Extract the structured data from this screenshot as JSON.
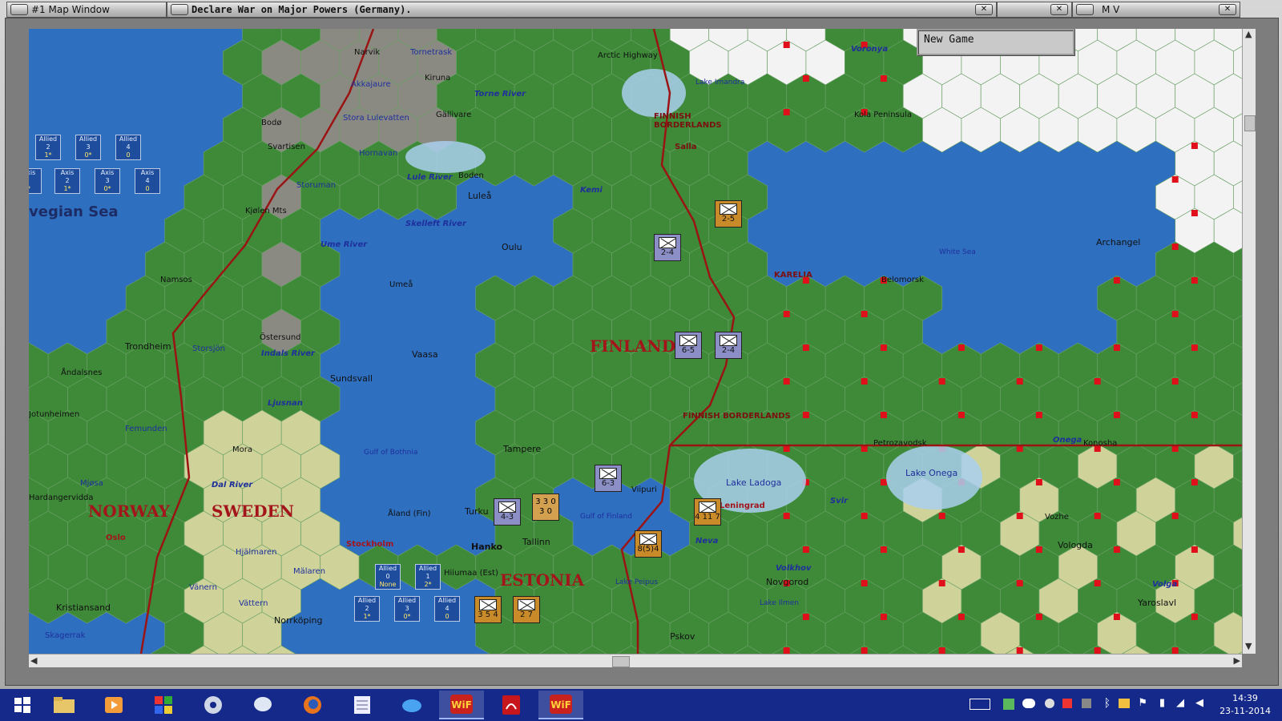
{
  "windows": {
    "map_window_title": "#1 Map Window",
    "main_title": "Declare War on Major Powers (Germany).",
    "mv_title": "M V",
    "panel_text": "New Game"
  },
  "map": {
    "ocean_label": "vegian Sea",
    "countries": [
      "FINLAND",
      "NORWAY",
      "SWEDEN",
      "ESTONIA"
    ],
    "regions": [
      "FINNISH BORDERLANDS",
      "FINNISH BORDERLANDS",
      "KARELIA"
    ],
    "seas": [
      "White Sea",
      "Gulf of Bothnia",
      "Gulf of Finland",
      "Lake Ladoga",
      "Lake Onega",
      "Lake Imandra",
      "Lake Peipus",
      "Lake Ilmen"
    ],
    "rivers": [
      "Torne River",
      "Lule River",
      "Ume River",
      "Skelleft River",
      "Indals River",
      "Ljusnan",
      "Dal River",
      "Kemi",
      "Onega",
      "Volga",
      "Svir",
      "Neva",
      "Volkhov",
      "Vozhe"
    ],
    "cities": [
      "Narvik",
      "Tornetrask",
      "Arctic Highway",
      "Voronya",
      "Kiruna",
      "Akkajaure",
      "Gällivare",
      "Bodø",
      "Stora Lulevatten",
      "Hornavan",
      "Svartisen",
      "Storuman",
      "Boden",
      "Luleå",
      "Kjølen Mts",
      "Kola Peninsula",
      "Salla",
      "Oulu",
      "Archangel",
      "Namsos",
      "Umeå",
      "Belomorsk",
      "Trondheim",
      "Storsjön",
      "Östersund",
      "Vaasa",
      "Sundsvall",
      "Åndalsnes",
      "Femunden",
      "Jotunheimen",
      "Mora",
      "Tampere",
      "Petrozavodsk",
      "Konosha",
      "Mjøsa",
      "Hardangervidda",
      "Viipuri",
      "Turku",
      "Åland (Fin)",
      "Leningrad",
      "Oslo",
      "Stockholm",
      "Hanko",
      "Tallinn",
      "Vologda",
      "Hjälmaren",
      "Mälaren",
      "Hiiumaa (Est)",
      "Novgorod",
      "Vänern",
      "Vättern",
      "Norrköping",
      "Kristiansand",
      "Skagerrak",
      "Yaroslavl",
      "Pskov"
    ]
  },
  "info_boxes": [
    {
      "side": "Allied",
      "num": "2",
      "val": "1*"
    },
    {
      "side": "Allied",
      "num": "3",
      "val": "0*"
    },
    {
      "side": "Allied",
      "num": "4",
      "val": "0"
    },
    {
      "side": "Axis",
      "num": "",
      "val": "*"
    },
    {
      "side": "Axis",
      "num": "2",
      "val": "1*"
    },
    {
      "side": "Axis",
      "num": "3",
      "val": "0*"
    },
    {
      "side": "Axis",
      "num": "4",
      "val": "0"
    },
    {
      "side": "Allied",
      "num": "0",
      "val": "None"
    },
    {
      "side": "Allied",
      "num": "1",
      "val": "2*"
    },
    {
      "side": "Allied",
      "num": "2",
      "val": "1*"
    },
    {
      "side": "Allied",
      "num": "3",
      "val": "0*"
    },
    {
      "side": "Allied",
      "num": "4",
      "val": "0"
    }
  ],
  "units": [
    {
      "type": "infantry",
      "side": "finnish",
      "strength": "2-4"
    },
    {
      "type": "infantry",
      "side": "finnish",
      "strength": "6-5"
    },
    {
      "type": "infantry",
      "side": "finnish",
      "strength": "2-4"
    },
    {
      "type": "infantry",
      "side": "finnish",
      "strength": "6-3"
    },
    {
      "type": "infantry",
      "side": "finnish",
      "strength": "4-3"
    },
    {
      "type": "mountain",
      "side": "soviet",
      "strength": "2-5"
    },
    {
      "type": "naval",
      "side": "soviet",
      "strength": "8(5)4"
    },
    {
      "type": "air",
      "side": "soviet",
      "strength": "4 11 7"
    },
    {
      "type": "air",
      "side": "soviet",
      "strength": "3 5 4"
    },
    {
      "type": "air",
      "side": "soviet",
      "strength": "2 7"
    },
    {
      "type": "naval",
      "side": "mixed",
      "strength": "3 3 0 3 0"
    }
  ],
  "taskbar": {
    "apps": [
      "start-icon",
      "file-explorer-icon",
      "media-player-icon",
      "games-icon",
      "disc-icon",
      "chat-icon",
      "firefox-icon",
      "notepad-icon",
      "cloud-icon",
      "wif-icon",
      "pdf-icon",
      "wif-icon"
    ],
    "time": "14:39",
    "date": "23-11-2014"
  },
  "colors": {
    "sea": "#2e6fc0",
    "forest": "#3e8a38",
    "clear": "#cfd39a",
    "mountain": "#8b8a82",
    "tundra": "#f3f3f3",
    "border": "#9a1414",
    "supply": "#e0101a"
  }
}
